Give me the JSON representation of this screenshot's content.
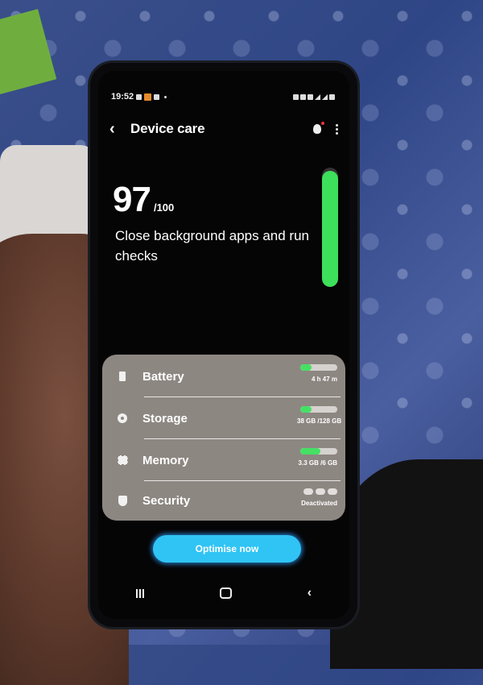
{
  "status_bar": {
    "time": "19:52"
  },
  "header": {
    "back_icon": "chevron-left-icon",
    "title": "Device care",
    "tips_icon": "lightbulb-icon",
    "more_icon": "more-vertical-icon"
  },
  "score": {
    "value": "97",
    "max": "/100",
    "gauge_fraction": 0.97,
    "message": "Close background apps and run checks"
  },
  "items": [
    {
      "label": "Battery",
      "icon": "battery-icon",
      "value": "4 h 47 m",
      "fill": 0.3
    },
    {
      "label": "Storage",
      "icon": "storage-icon",
      "value": "38 GB /128 GB",
      "fill": 0.3
    },
    {
      "label": "Memory",
      "icon": "memory-icon",
      "value": "3.3 GB /6 GB",
      "fill": 0.55
    },
    {
      "label": "Security",
      "icon": "shield-icon",
      "value": "Deactivated"
    }
  ],
  "actions": {
    "optimise_label": "Optimise now"
  },
  "colors": {
    "accent": "#2fc4f4",
    "good": "#3de05a",
    "card": "#8d8782"
  }
}
